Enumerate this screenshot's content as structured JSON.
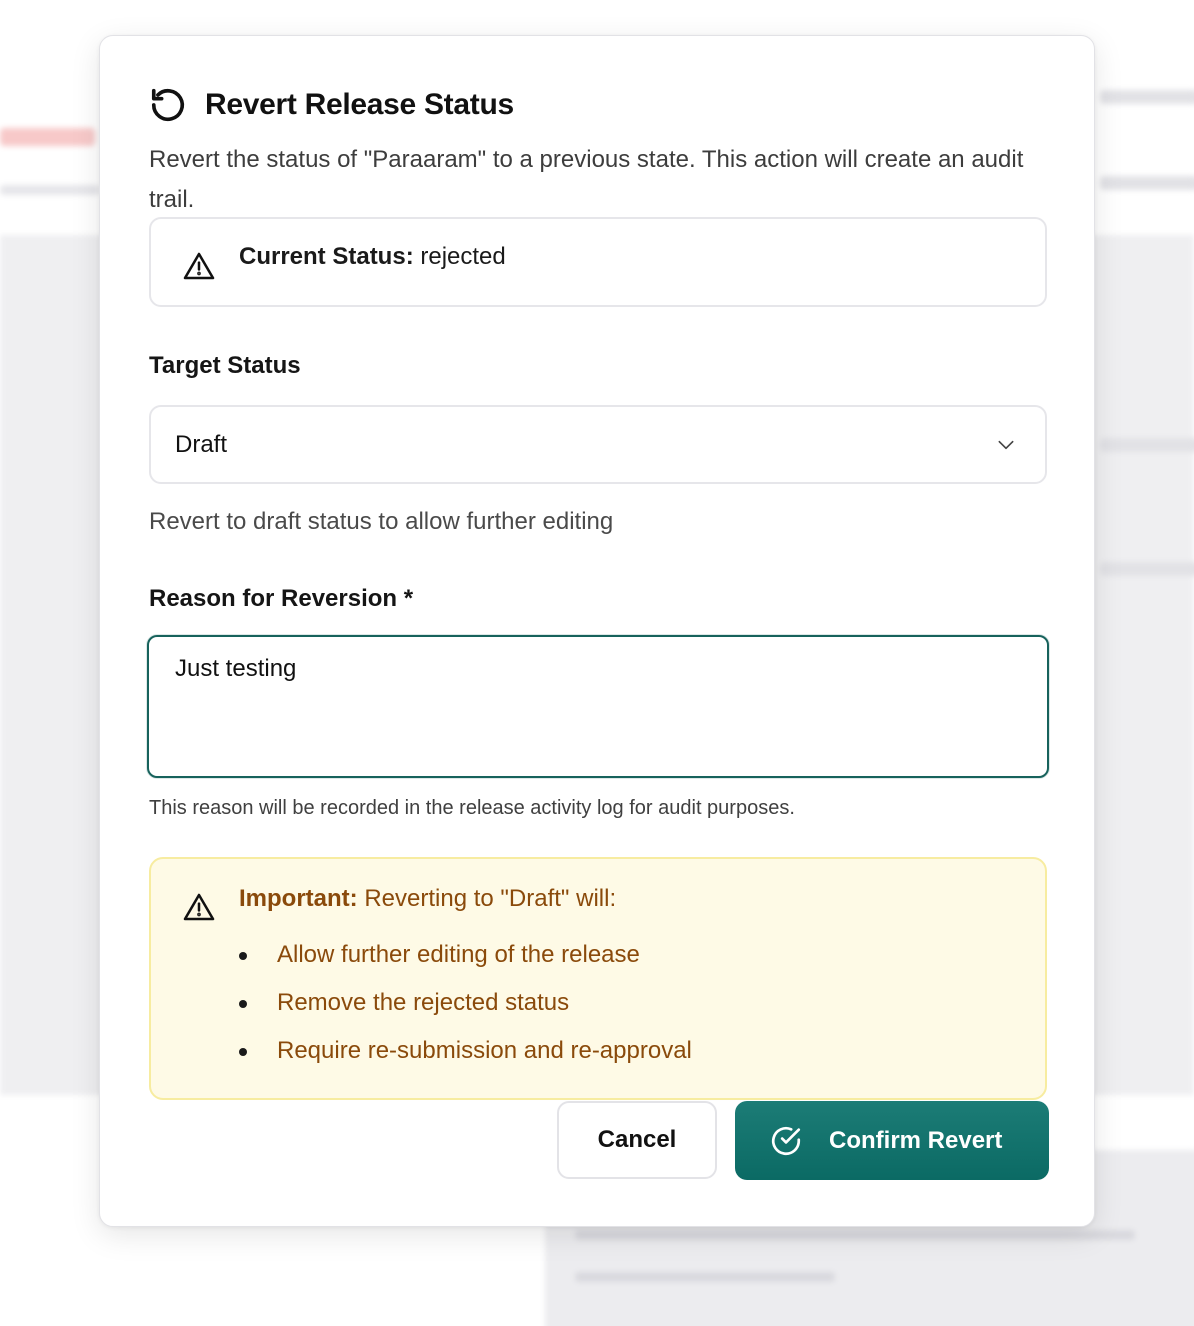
{
  "dialog": {
    "title": "Revert Release Status",
    "description": "Revert the status of \"Paraaram\" to a previous state. This action will create an audit trail."
  },
  "current_status": {
    "label": "Current Status:",
    "value": "rejected"
  },
  "target_status": {
    "label": "Target Status",
    "selected": "Draft",
    "help": "Revert to draft status to allow further editing"
  },
  "reason": {
    "label": "Reason for Reversion *",
    "value": "Just testing",
    "help": "This reason will be recorded in the release activity log for audit purposes."
  },
  "important": {
    "label": "Important:",
    "text": "Reverting to \"Draft\" will:",
    "items": [
      "Allow further editing of the release",
      "Remove the rejected status",
      "Require re-submission and re-approval"
    ]
  },
  "buttons": {
    "cancel": "Cancel",
    "confirm": "Confirm Revert"
  },
  "colors": {
    "primary": "#0b6a64",
    "warning_text": "#8a4a0b",
    "warning_bg": "#fefae6"
  },
  "icons": {
    "title": "revert-icon",
    "status": "warning-icon",
    "select": "chevron-down-icon",
    "confirm": "check-circle-icon"
  }
}
